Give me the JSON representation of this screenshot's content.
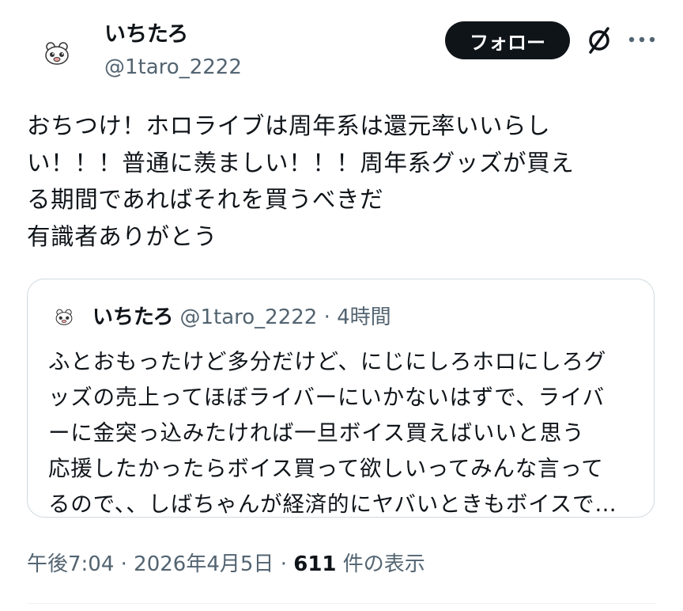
{
  "tweet": {
    "author_name": "いちたろ",
    "author_handle": "@1taro_2222",
    "follow_label": "フォロー",
    "text": "おちつけ！ホロライブは周年系は還元率いいらし\nい！！！普通に羨ましい！！！周年系グッズが買え\nる期間であればそれを買うべきだ\n有識者ありがとう",
    "timestamp": "午後7:04 · 2026年4月5日 · ",
    "views_count": "611",
    "views_label": " 件の表示"
  },
  "quote": {
    "author_name": "いちたろ",
    "meta": "@1taro_2222 · 4時間",
    "text": "ふとおもったけど多分だけど、にじにしろホロにしろグ\nッズの売上ってほぼライバーにいかないはずで、ライバ\nーに金突っ込みたければ一旦ボイス買えばいいと思う\n応援したかったらボイス買って欲しいってみんな言って\nるので、、しばちゃんが経済的にヤバいときもボイスで…"
  },
  "icons": [
    "grok-icon",
    "more-icon"
  ]
}
